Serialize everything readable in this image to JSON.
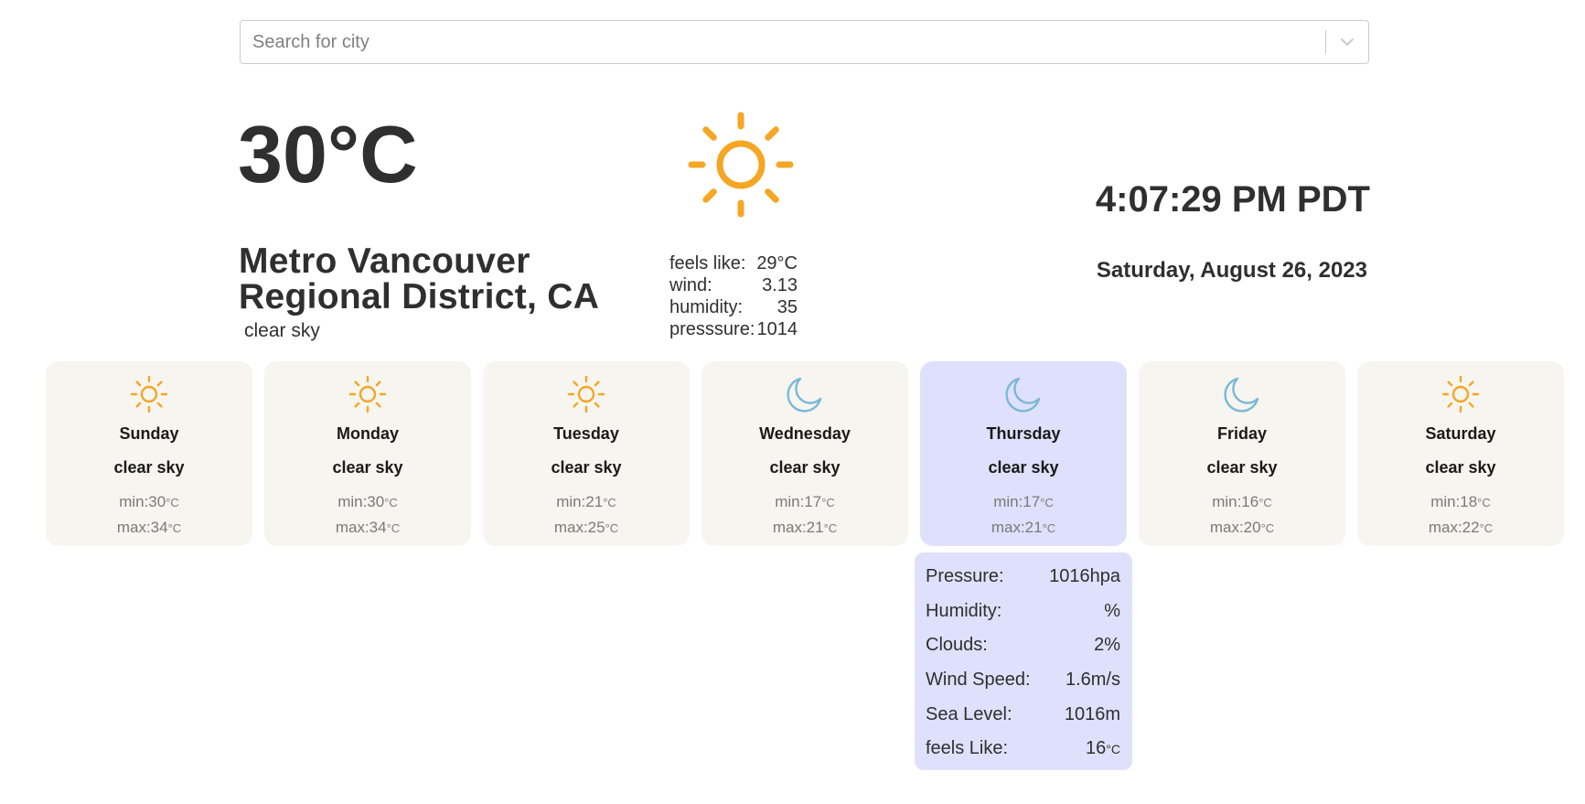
{
  "search": {
    "placeholder": "Search for city"
  },
  "current": {
    "temperature": "30°C",
    "city_line1": "Metro Vancouver",
    "city_line2": "Regional District, CA",
    "description": "clear sky",
    "icon": "sun-icon",
    "time": "4:07:29 PM PDT",
    "date": "Saturday, August 26, 2023",
    "details": [
      {
        "label": "feels like:",
        "value": "29°C"
      },
      {
        "label": "wind:",
        "value": "3.13"
      },
      {
        "label": "humidity:",
        "value": "35"
      },
      {
        "label": "presssure:",
        "value": "1014"
      }
    ]
  },
  "forecast": [
    {
      "day": "Sunday",
      "description": "clear sky",
      "min": "min:30",
      "max": "max:34",
      "unit": "°C",
      "icon": "sun-icon",
      "active": false
    },
    {
      "day": "Monday",
      "description": "clear sky",
      "min": "min:30",
      "max": "max:34",
      "unit": "°C",
      "icon": "sun-icon",
      "active": false
    },
    {
      "day": "Tuesday",
      "description": "clear sky",
      "min": "min:21",
      "max": "max:25",
      "unit": "°C",
      "icon": "sun-icon",
      "active": false
    },
    {
      "day": "Wednesday",
      "description": "clear sky",
      "min": "min:17",
      "max": "max:21",
      "unit": "°C",
      "icon": "moon-icon",
      "active": false
    },
    {
      "day": "Thursday",
      "description": "clear sky",
      "min": "min:17",
      "max": "max:21",
      "unit": "°C",
      "icon": "moon-icon",
      "active": true
    },
    {
      "day": "Friday",
      "description": "clear sky",
      "min": "min:16",
      "max": "max:20",
      "unit": "°C",
      "icon": "moon-icon",
      "active": false
    },
    {
      "day": "Saturday",
      "description": "clear sky",
      "min": "min:18",
      "max": "max:22",
      "unit": "°C",
      "icon": "sun-icon",
      "active": false
    }
  ],
  "detail_popup": {
    "rows": [
      {
        "label": "Pressure:",
        "value": "1016hpa"
      },
      {
        "label": "Humidity:",
        "value": "%"
      },
      {
        "label": "Clouds:",
        "value": "2%"
      },
      {
        "label": "Wind Speed:",
        "value": "1.6m/s"
      },
      {
        "label": "Sea Level:",
        "value": "1016m"
      },
      {
        "label": "feels Like:",
        "value": "16",
        "unit": "°C"
      }
    ]
  },
  "colors": {
    "sun": "#f5a623",
    "moon": "#7ab8d6",
    "card_bg": "#f6f5f0",
    "card_active_bg": "#dfe0fb",
    "text": "#2f2f2f"
  }
}
